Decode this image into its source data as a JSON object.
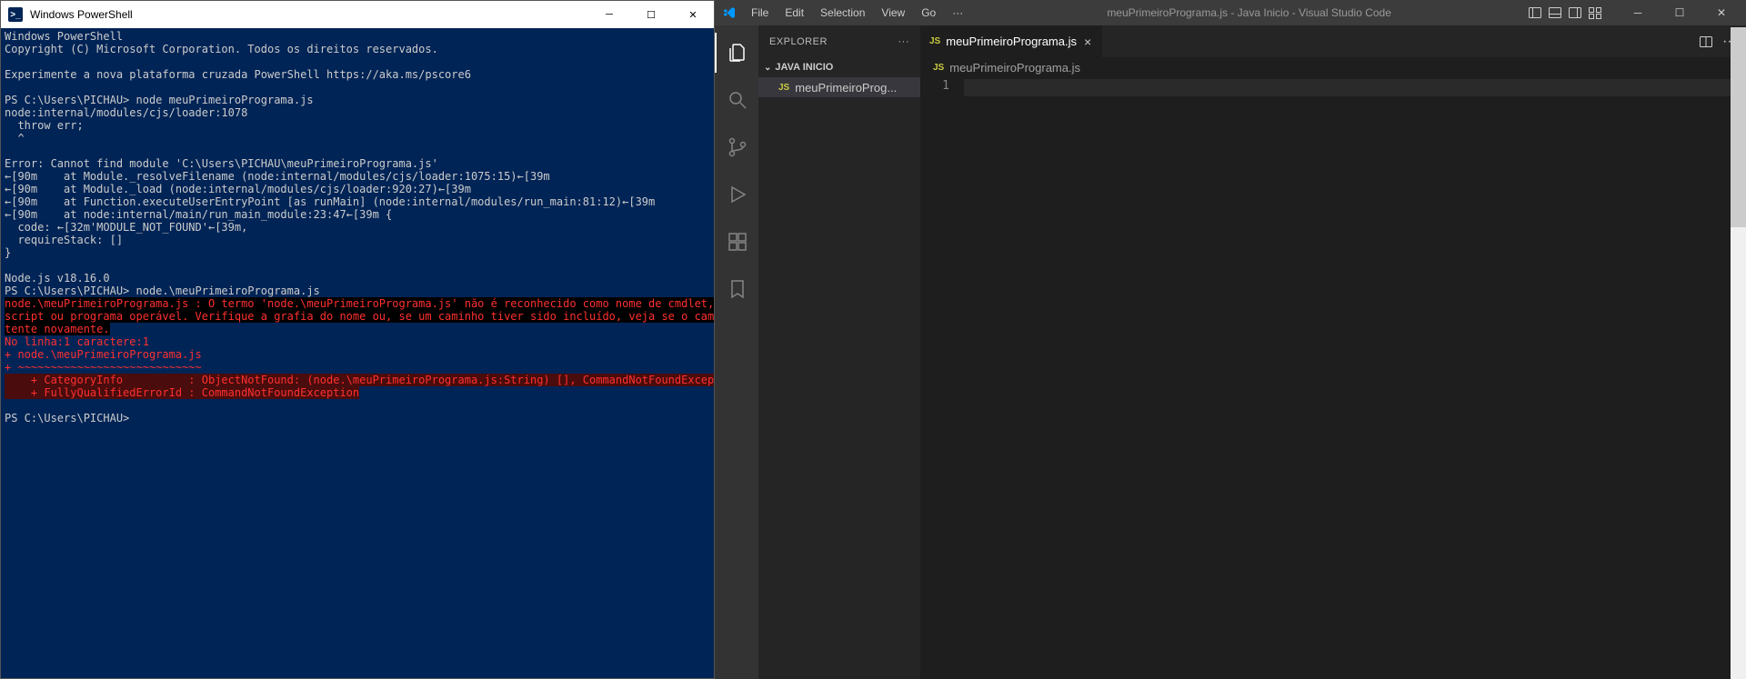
{
  "powershell": {
    "title": "Windows PowerShell",
    "lines": {
      "l1": "Windows PowerShell",
      "l2": "Copyright (C) Microsoft Corporation. Todos os direitos reservados.",
      "l3": "",
      "l4": "Experimente a nova plataforma cruzada PowerShell https://aka.ms/pscore6",
      "l5": "",
      "l6": "PS C:\\Users\\PICHAU> node meuPrimeiroPrograma.js",
      "l7": "node:internal/modules/cjs/loader:1078",
      "l8": "  throw err;",
      "l9": "  ^",
      "l10": "",
      "l11": "Error: Cannot find module 'C:\\Users\\PICHAU\\meuPrimeiroPrograma.js'",
      "l12": "←[90m    at Module._resolveFilename (node:internal/modules/cjs/loader:1075:15)←[39m",
      "l13": "←[90m    at Module._load (node:internal/modules/cjs/loader:920:27)←[39m",
      "l14": "←[90m    at Function.executeUserEntryPoint [as runMain] (node:internal/modules/run_main:81:12)←[39m",
      "l15": "←[90m    at node:internal/main/run_main_module:23:47←[39m {",
      "l16": "  code: ←[32m'MODULE_NOT_FOUND'←[39m,",
      "l17": "  requireStack: []",
      "l18": "}",
      "l19": "",
      "l20": "Node.js v18.16.0",
      "l21": "PS C:\\Users\\PICHAU> node.\\meuPrimeiroPrograma.js",
      "e1": "node.\\meuPrimeiroPrograma.js : O termo 'node.\\meuPrimeiroPrograma.js' não é reconhecido como nome de cmdlet, função, arquivo de",
      "e2": "script ou programa operável. Verifique a grafia do nome ou, se um caminho tiver sido incluído, veja se o caminho está correto e",
      "e3": "tente novamente.",
      "e4": "No linha:1 caractere:1",
      "e5": "+ node.\\meuPrimeiroPrograma.js",
      "e6": "+ ~~~~~~~~~~~~~~~~~~~~~~~~~~~~",
      "e7": "    + CategoryInfo          : ObjectNotFound: (node.\\meuPrimeiroPrograma.js:String) [], CommandNotFoundException",
      "e8": "    + FullyQualifiedErrorId : CommandNotFoundException",
      "l32": " ",
      "l33": "PS C:\\Users\\PICHAU>"
    }
  },
  "vscode": {
    "menus": {
      "file": "File",
      "edit": "Edit",
      "selection": "Selection",
      "view": "View",
      "go": "Go",
      "more": "···"
    },
    "title": "meuPrimeiroPrograma.js - Java Inicio - Visual Studio Code",
    "sidebar": {
      "header": "EXPLORER",
      "section": "JAVA INICIO",
      "file": "meuPrimeiroProg...",
      "jsLabel": "JS"
    },
    "tab": {
      "label": "meuPrimeiroPrograma.js",
      "jsLabel": "JS"
    },
    "breadcrumb": {
      "file": "meuPrimeiroPrograma.js",
      "jsLabel": "JS"
    },
    "editor": {
      "line1": "1"
    }
  }
}
